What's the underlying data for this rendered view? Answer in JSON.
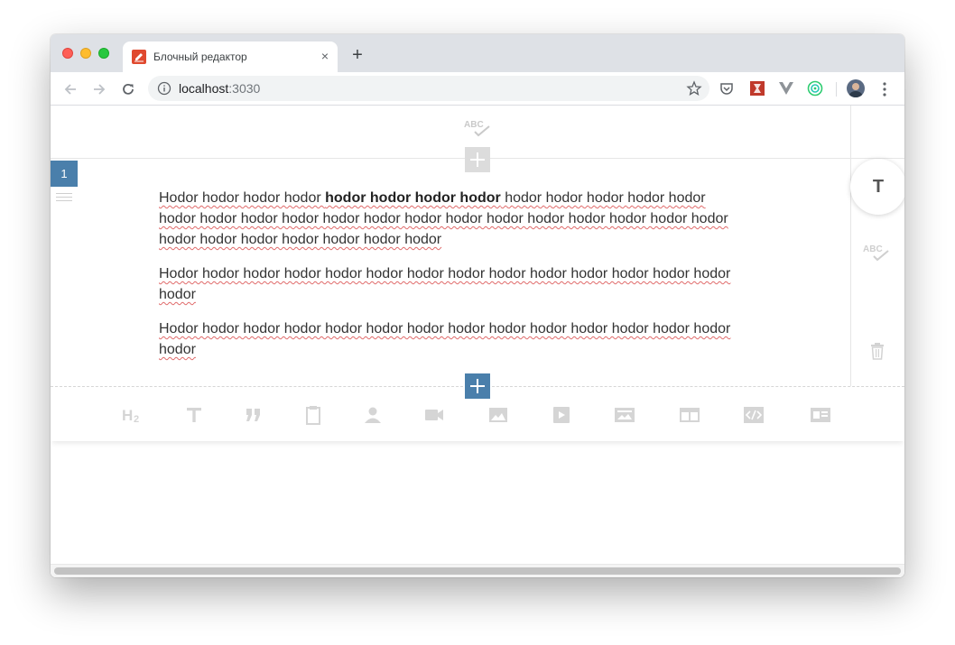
{
  "browser": {
    "tab_title": "Блочный редактор",
    "tab_close": "×",
    "new_tab": "+",
    "url_host": "localhost",
    "url_port": ":3030"
  },
  "editor": {
    "block_number": "1",
    "side_format_label": "T",
    "paragraphs": [
      {
        "before": "Hodor hodor hodor hodor ",
        "bold": "hodor hodor hodor hodor",
        "after": " hodor hodor hodor hodor hodor hodor hodor hodor hodor hodor hodor hodor hodor hodor hodor hodor hodor hodor hodor hodor hodor hodor hodor hodor hodor hodor"
      },
      {
        "text": "Hodor hodor hodor hodor hodor hodor hodor hodor hodor hodor hodor hodor hodor hodor hodor"
      },
      {
        "text": "Hodor hodor hodor hodor hodor hodor hodor hodor hodor hodor hodor hodor hodor hodor hodor"
      }
    ],
    "block_types": [
      "heading-h2-icon",
      "text-icon",
      "quote-icon",
      "clipboard-icon",
      "person-icon",
      "video-camera-icon",
      "image-icon",
      "video-play-icon",
      "gallery-icon",
      "layout-icon",
      "code-icon",
      "card-icon"
    ]
  },
  "colors": {
    "accent": "#4a7fab",
    "spell_underline": "#e06a6a",
    "toolbar_icon": "#d5d5d5"
  }
}
